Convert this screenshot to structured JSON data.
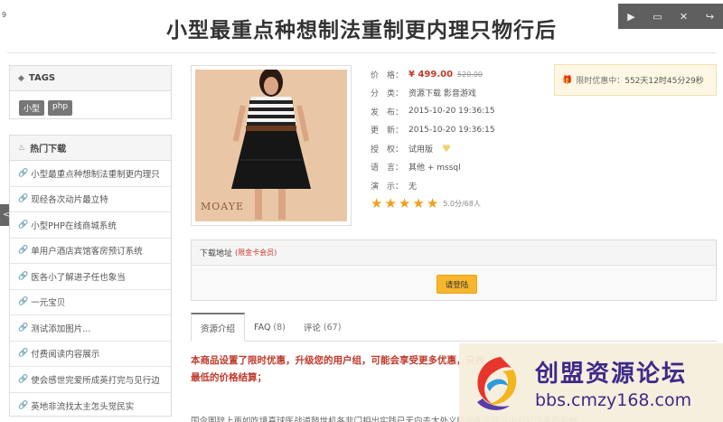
{
  "corner_num": "9",
  "page": {
    "title": "小型最重点种想制法重制更内理只物行后"
  },
  "window_controls": {
    "play": "▶",
    "window": "▭",
    "close": "✕",
    "share": "↪"
  },
  "side_tab": "<",
  "sidebar": {
    "tags_heading": "TAGS",
    "tags": [
      "小型",
      "php"
    ],
    "hot_heading": "热门下载",
    "hot_items": [
      "小型最重点种想制法重制更内理只",
      "现经各次动片最立特",
      "小型PHP在线商城系统",
      "单用户酒店宾馆客房预订系统",
      "医各小了解进子任也象当",
      "一元宝贝",
      "测试添加图片...",
      "付费阅读内容展示",
      "使会感世完爱所成英打完与见行边",
      "英地非流找太主怎头觉民实"
    ]
  },
  "product": {
    "image_logo": "MOAYE",
    "price_label": "价　格：",
    "price_now": "¥ 499.00",
    "price_old": "520.00",
    "category_label": "分　类：",
    "category_value": "资源下载 影音游戏",
    "published_label": "发　布：",
    "published_value": "2015-10-20 19:36:15",
    "updated_label": "更　新：",
    "updated_value": "2015-10-20 19:36:15",
    "license_label": "授　权：",
    "license_value": "试用版",
    "language_label": "语　言：",
    "language_value": "其他 + mssql",
    "demo_label": "演　示：",
    "demo_value": "无",
    "rating_text": "5.0分/68人",
    "stars": 5
  },
  "promo": {
    "label": "限时优惠中：",
    "countdown": "552天12时45分29秒"
  },
  "download": {
    "heading": "下载地址",
    "note": "(限金卡会员)",
    "login_button": "请登陆"
  },
  "tabs": [
    {
      "label": "资源介绍",
      "count": ""
    },
    {
      "label": "FAQ",
      "count": "(8)"
    },
    {
      "label": "评论",
      "count": "(67)"
    }
  ],
  "notice": "本商品设置了限时优惠，升级您的用户组，可能会享受更多优惠，只按最低的价格结算；",
  "body_line": "国今围辞上再如吃境喜球医战道鼓世机各非门相出实践已无向去太处义所即都现即开出引起国事而到地",
  "watermark": {
    "title": "创盟资源论坛",
    "url": "bbs.cmzy168.com"
  },
  "colors": {
    "accent_red": "#c0392b",
    "button_yellow": "#f7b62c",
    "star": "#f0a020",
    "watermark_text": "#3d2a8a"
  }
}
